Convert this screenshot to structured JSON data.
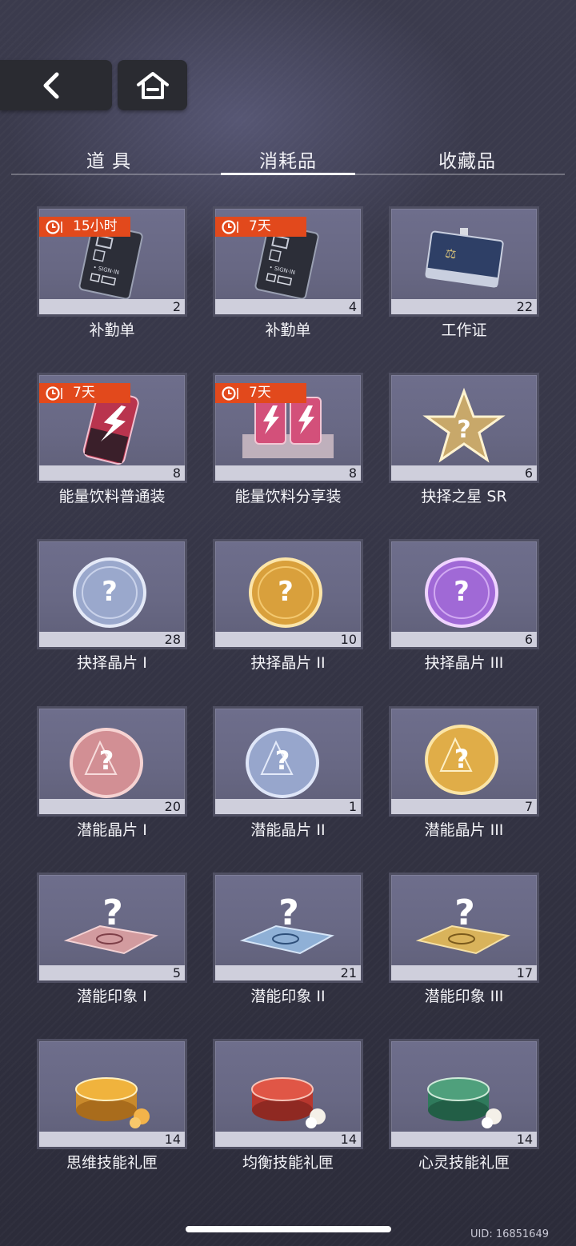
{
  "nav": {
    "back_icon": "chevron-left-icon",
    "home_icon": "home-icon"
  },
  "tabs": [
    {
      "label": "道 具",
      "active": false
    },
    {
      "label": "消耗品",
      "active": true
    },
    {
      "label": "收藏品",
      "active": false
    }
  ],
  "items": [
    {
      "name": "补勤单",
      "count": "2",
      "timer": "15小时",
      "icon": "sign-in-card-icon"
    },
    {
      "name": "补勤单",
      "count": "4",
      "timer": "7天",
      "icon": "sign-in-card-icon"
    },
    {
      "name": "工作证",
      "count": "22",
      "timer": "",
      "icon": "work-badge-icon"
    },
    {
      "name": "能量饮料普通装",
      "count": "8",
      "timer": "7天",
      "icon": "energy-drink-icon"
    },
    {
      "name": "能量饮料分享装",
      "count": "8",
      "timer": "7天",
      "icon": "energy-drink-pack-icon"
    },
    {
      "name": "抉择之星 SR",
      "count": "6",
      "timer": "",
      "icon": "star-question-icon"
    },
    {
      "name": "抉择晶片 I",
      "count": "28",
      "timer": "",
      "icon": "choice-chip-silver-icon"
    },
    {
      "name": "抉择晶片 II",
      "count": "10",
      "timer": "",
      "icon": "choice-chip-gold-icon"
    },
    {
      "name": "抉择晶片 III",
      "count": "6",
      "timer": "",
      "icon": "choice-chip-purple-icon"
    },
    {
      "name": "潜能晶片 I",
      "count": "20",
      "timer": "",
      "icon": "potential-chip-pink-icon"
    },
    {
      "name": "潜能晶片 II",
      "count": "1",
      "timer": "",
      "icon": "potential-chip-blue-icon"
    },
    {
      "name": "潜能晶片 III",
      "count": "7",
      "timer": "",
      "icon": "potential-chip-gold-icon"
    },
    {
      "name": "潜能印象 I",
      "count": "5",
      "timer": "",
      "icon": "potential-impression-pink-icon"
    },
    {
      "name": "潜能印象 II",
      "count": "21",
      "timer": "",
      "icon": "potential-impression-blue-icon"
    },
    {
      "name": "潜能印象 III",
      "count": "17",
      "timer": "",
      "icon": "potential-impression-gold-icon"
    },
    {
      "name": "思维技能礼匣",
      "count": "14",
      "timer": "",
      "icon": "skill-box-gold-icon"
    },
    {
      "name": "均衡技能礼匣",
      "count": "14",
      "timer": "",
      "icon": "skill-box-red-icon"
    },
    {
      "name": "心灵技能礼匣",
      "count": "14",
      "timer": "",
      "icon": "skill-box-green-icon"
    }
  ],
  "uid": "UID: 16851649"
}
